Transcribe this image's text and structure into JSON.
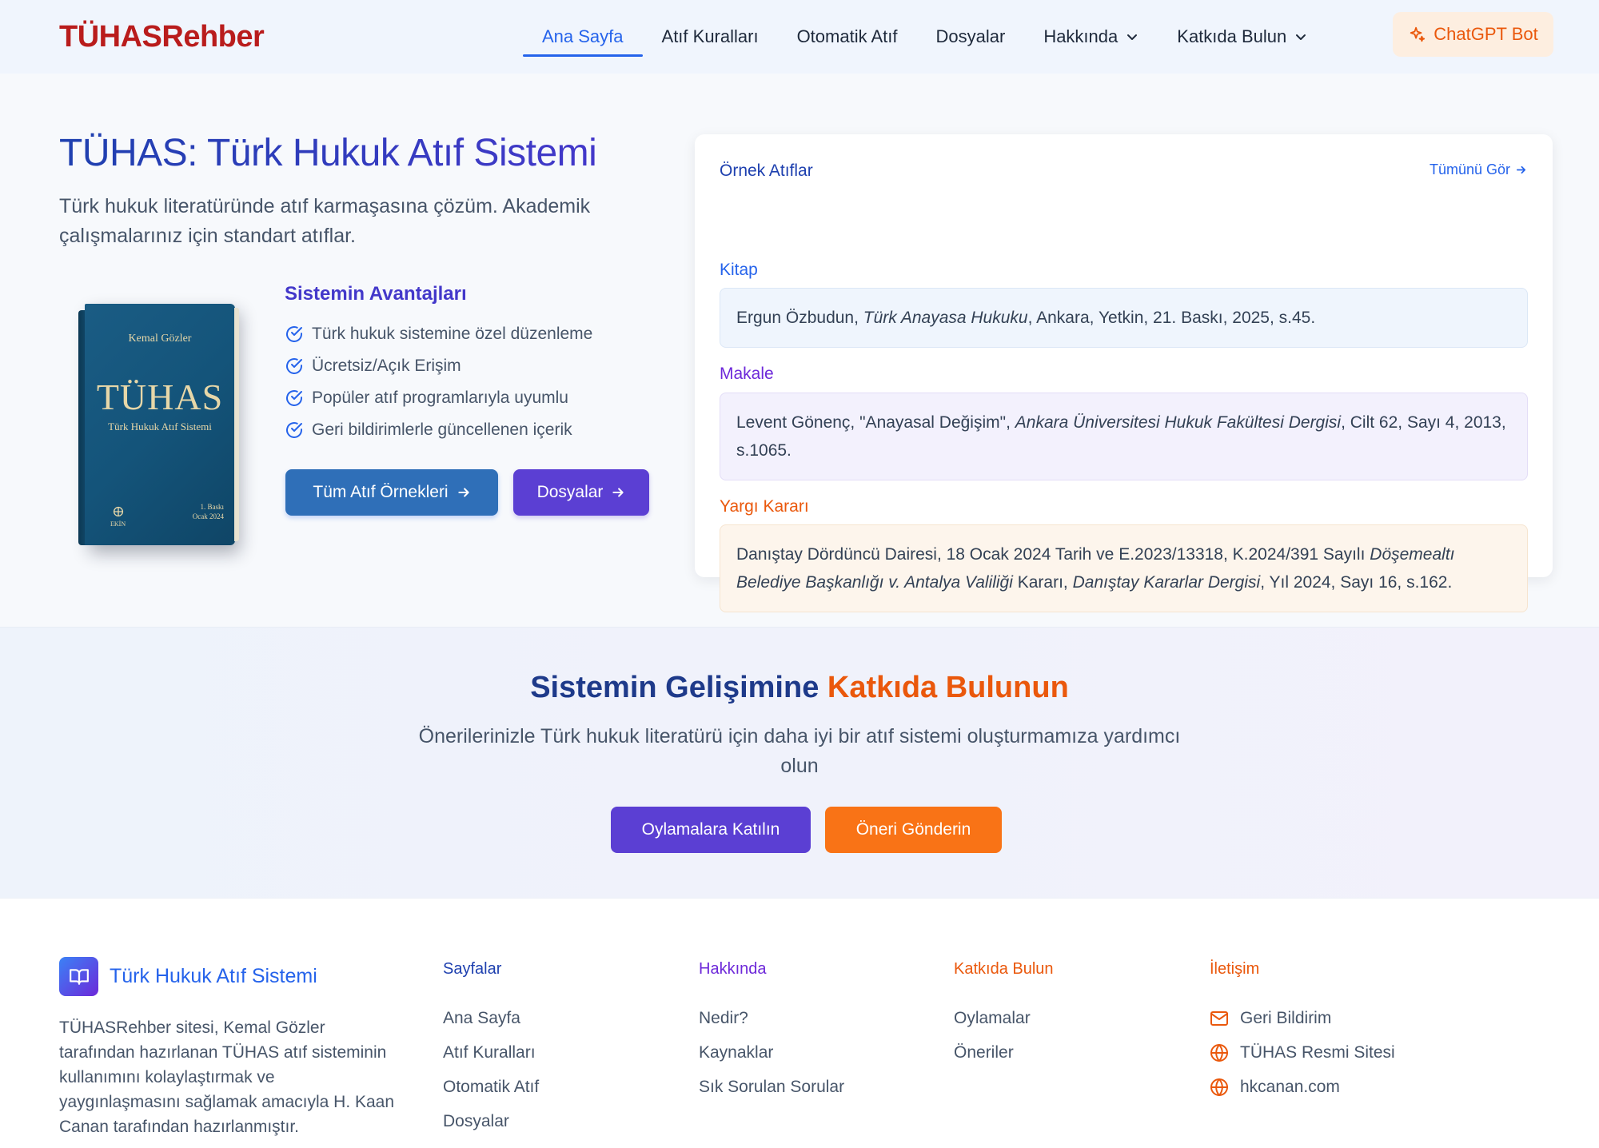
{
  "header": {
    "logo": "TÜHASRehber",
    "nav": [
      {
        "label": "Ana Sayfa",
        "active": true
      },
      {
        "label": "Atıf Kuralları"
      },
      {
        "label": "Otomatik Atıf"
      },
      {
        "label": "Dosyalar"
      },
      {
        "label": "Hakkında",
        "dropdown": true
      },
      {
        "label": "Katkıda Bulun",
        "dropdown": true
      }
    ],
    "bot_label": "ChatGPT Bot"
  },
  "hero": {
    "title": "TÜHAS: Türk Hukuk Atıf Sistemi",
    "subtitle": "Türk hukuk literatüründe atıf karmaşasına çözüm. Akademik çalışmalarınız için standart atıflar.",
    "book": {
      "author": "Kemal Gözler",
      "title": "TÜHAS",
      "subtitle": "Türk Hukuk Atıf Sistemi",
      "edition_line1": "1. Baskı",
      "edition_line2": "Ocak 2024",
      "publisher": "EKİN"
    },
    "advantages_title": "Sistemin Avantajları",
    "advantages": [
      "Türk hukuk sistemine özel düzenleme",
      "Ücretsiz/Açık Erişim",
      "Popüler atıf programlarıyla uyumlu",
      "Geri bildirimlerle güncellenen içerik"
    ],
    "btn_examples": "Tüm Atıf Örnekleri",
    "btn_files": "Dosyalar"
  },
  "examples": {
    "title": "Örnek Atıflar",
    "see_all": "Tümünü Gör",
    "book_label": "Kitap",
    "book_pre": "Ergun Özbudun, ",
    "book_italic": "Türk Anayasa Hukuku",
    "book_post": ", Ankara, Yetkin, 21. Baskı, 2025, s.45.",
    "article_label": "Makale",
    "article_pre": "Levent Gönenç, \"Anayasal Değişim\", ",
    "article_italic": "Ankara Üniversitesi Hukuk Fakültesi Dergisi",
    "article_post": ", Cilt 62, Sayı 4, 2013, s.1065.",
    "court_label": "Yargı Kararı",
    "court_pre": "Danıştay Dördüncü Dairesi, 18 Ocak 2024 Tarih ve E.2023/13318, K.2024/391 Sayılı ",
    "court_italic1": "Döşemealtı Belediye Başkanlığı v. Antalya Valiliği",
    "court_mid": " Kararı, ",
    "court_italic2": "Danıştay Kararlar Dergisi",
    "court_post": ", Yıl 2024, Sayı 16, s.162."
  },
  "contribute": {
    "title_main": "Sistemin Gelişimine ",
    "title_accent": "Katkıda Bulunun",
    "subtitle": "Önerilerinizle Türk hukuk literatürü için daha iyi bir atıf sistemi oluşturmamıza yardımcı olun",
    "btn_vote": "Oylamalara Katılın",
    "btn_suggest": "Öneri Gönderin"
  },
  "footer": {
    "brand": "Türk Hukuk Atıf Sistemi",
    "description": "TÜHASRehber sitesi, Kemal Gözler tarafından hazırlanan TÜHAS atıf sisteminin kullanımını kolaylaştırmak ve yaygınlaşmasını sağlamak amacıyla H. Kaan Canan tarafından hazırlanmıştır.",
    "pages_title": "Sayfalar",
    "pages": [
      "Ana Sayfa",
      "Atıf Kuralları",
      "Otomatik Atıf",
      "Dosyalar"
    ],
    "about_title": "Hakkında",
    "about": [
      "Nedir?",
      "Kaynaklar",
      "Sık Sorulan Sorular"
    ],
    "contribute_title": "Katkıda Bulun",
    "contribute": [
      "Oylamalar",
      "Öneriler"
    ],
    "contact_title": "İletişim",
    "contact": [
      "Geri Bildirim",
      "TÜHAS Resmi Sitesi",
      "hkcanan.com"
    ]
  },
  "colors": {
    "brand_red": "#b91c1c",
    "primary_blue": "#2f6fb8",
    "violet": "#5b3fd3",
    "orange": "#f97316"
  },
  "icons": {
    "nav_dropdown": "chevron-down-icon",
    "bot": "sparkle-icon",
    "advantage": "check-circle-icon",
    "button_arrow": "arrow-right-icon",
    "footer_brand": "book-open-icon",
    "contact_feedback": "mail-icon",
    "contact_sites": "globe-icon"
  }
}
